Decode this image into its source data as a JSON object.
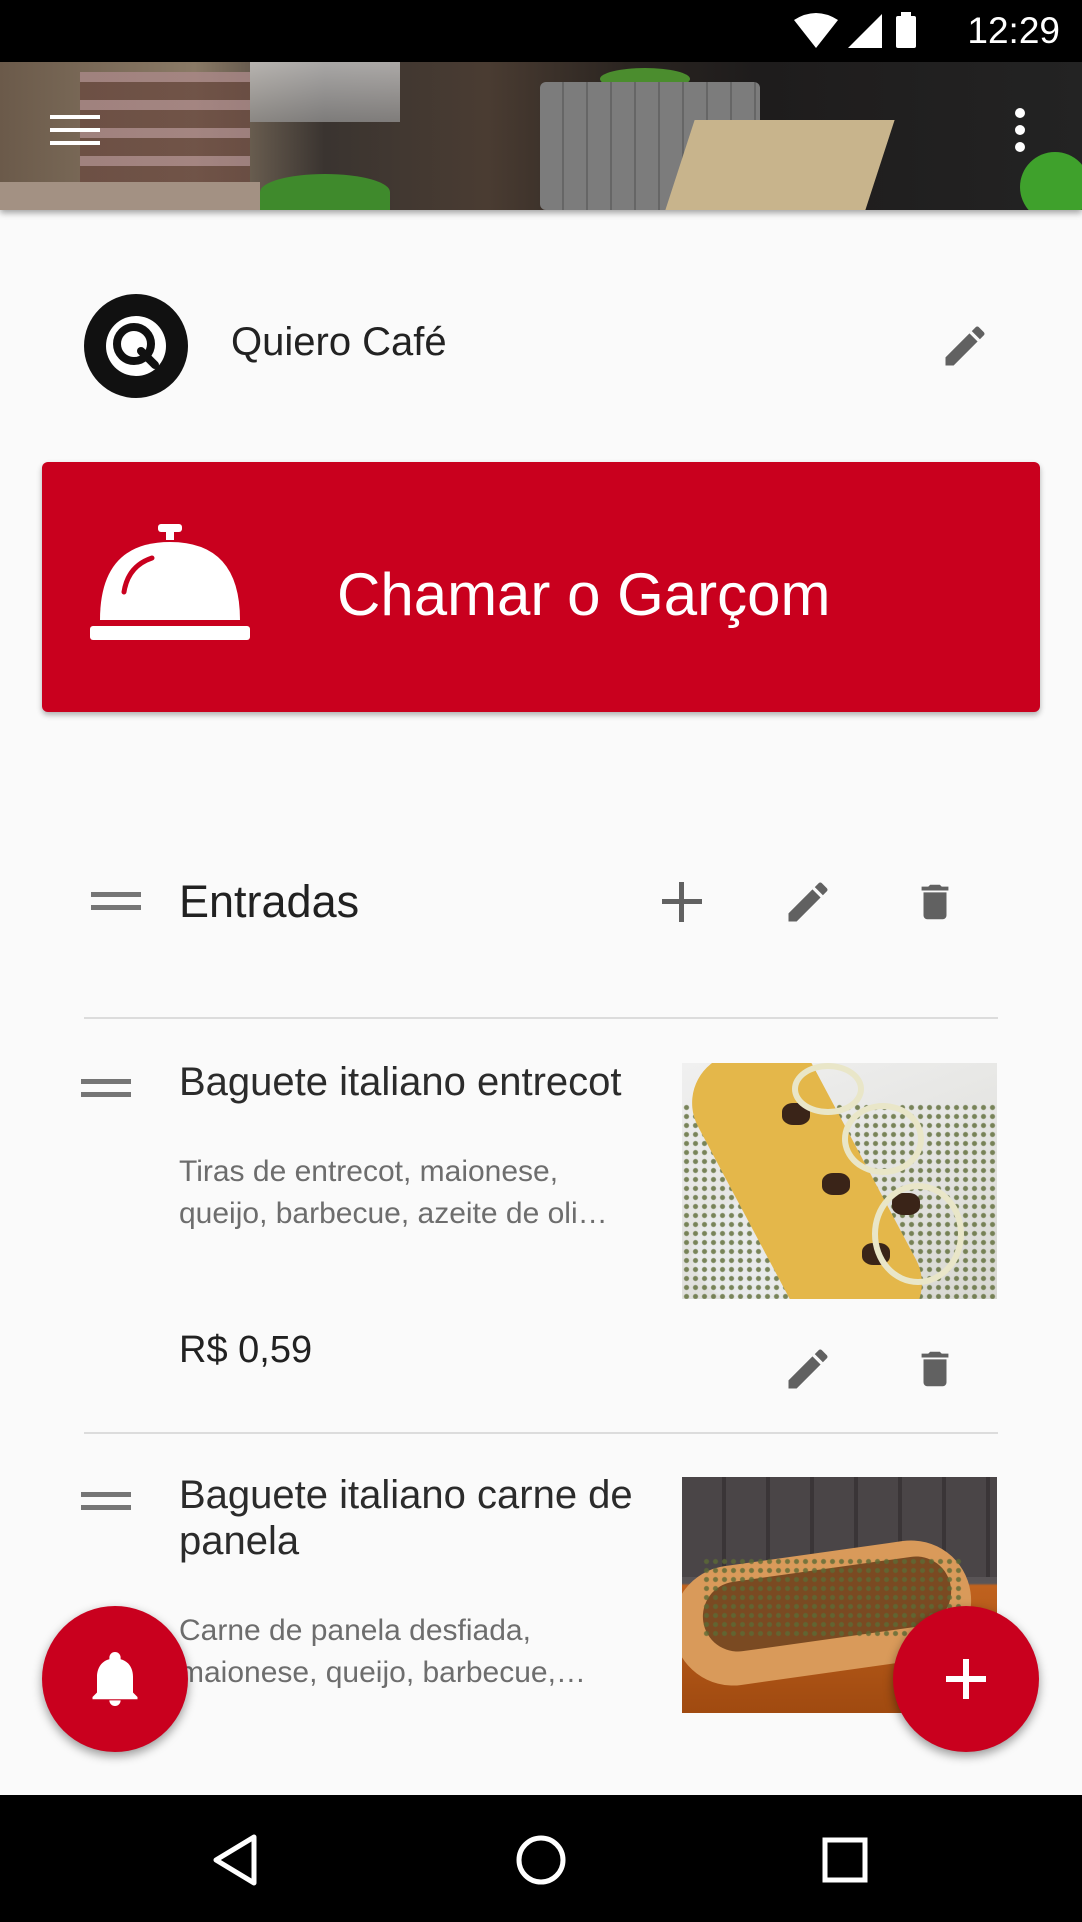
{
  "status_bar": {
    "time": "12:29"
  },
  "restaurant": {
    "name": "Quiero Café"
  },
  "call_waiter": {
    "label": "Chamar o Garçom"
  },
  "category": {
    "title": "Entradas"
  },
  "items": [
    {
      "name": "Baguete italiano entrecot",
      "description": "Tiras de entrecot, maionese, queijo, barbecue, azeite de oli…",
      "price": "R$ 0,59"
    },
    {
      "name": "Baguete italiano carne de panela",
      "description": "Carne de panela desfiada, maionese, queijo, barbecue,…"
    }
  ],
  "colors": {
    "accent": "#c9001e",
    "background": "#fafafa"
  }
}
